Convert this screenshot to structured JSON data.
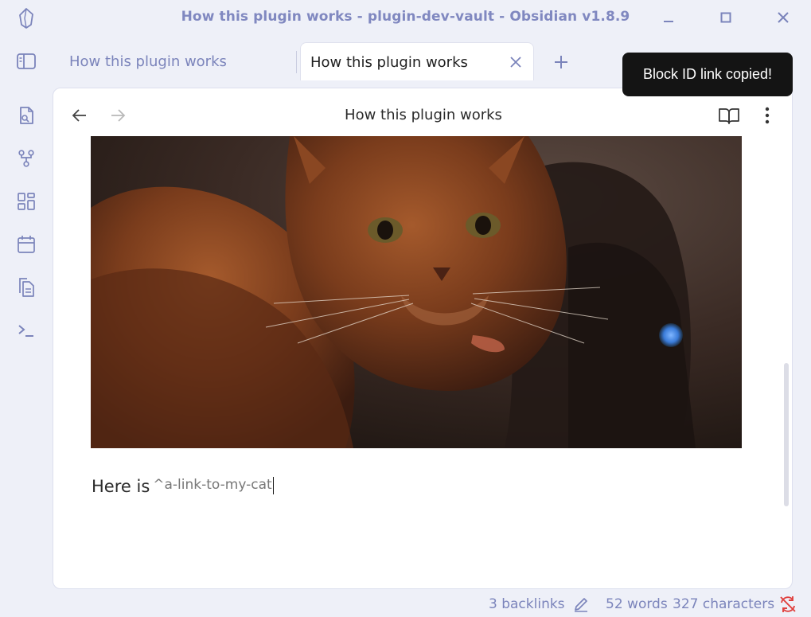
{
  "window": {
    "title": "How this plugin works - plugin-dev-vault - Obsidian v1.8.9"
  },
  "tabs": [
    {
      "label": "How this plugin works",
      "active": false
    },
    {
      "label": "How this plugin works",
      "active": true
    }
  ],
  "icons": {
    "app": "obsidian-logo-icon",
    "minimize": "minimize-icon",
    "maximize": "maximize-icon",
    "close": "close-icon",
    "sidebar_toggle": "sidebar-left-icon",
    "tab_close": "x-icon",
    "new_tab": "plus-icon",
    "tab_list": "chevron-down-icon",
    "right_sidebar": "sidebar-right-icon",
    "ribbon": [
      "file-search-icon",
      "graph-icon",
      "layout-dashboard-icon",
      "calendar-icon",
      "files-copy-icon",
      "terminal-icon"
    ],
    "back": "arrow-left-icon",
    "forward": "arrow-right-icon",
    "reading_view": "book-open-icon",
    "more": "more-vertical-icon",
    "edit": "pencil-icon",
    "sync": "sync-off-icon"
  },
  "view": {
    "title": "How this plugin works"
  },
  "editor": {
    "image_alt": "cat",
    "text": "Here is",
    "block_id": "^a-link-to-my-cat"
  },
  "status": {
    "backlinks": "3 backlinks",
    "words": "52 words",
    "characters": "327 characters"
  },
  "toast": {
    "message": "Block ID link copied!"
  },
  "colors": {
    "accent": "#7b84bb",
    "sync_error": "#e0413f",
    "toast_bg": "#141414"
  }
}
